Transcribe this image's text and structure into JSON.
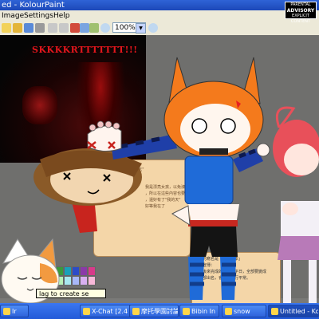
{
  "window": {
    "title": "ed - KolourPaint"
  },
  "menu": {
    "items": [
      "Image",
      "Settings",
      "Help"
    ]
  },
  "toolbar": {
    "zoom_value": "100%"
  },
  "canvas": {
    "photo_caption": "SKKKKRTTTTTTT!!!",
    "parental_label_top": "PARENTAL",
    "parental_label_main": "ADVISORY",
    "parental_label_bottom": "EXPLICIT CONTENT"
  },
  "speech_card": {
    "lines": [
      "將\"玉\"",
      "我是漂亮女孩，以免淑芸飛",
      "，所以在這些內容也要處理這",
      "，還好有了\"我的天\"",
      "好等我在了"
    ]
  },
  "note_card": {
    "lines": [
      "今天的寫名是「說說劇本」",
      "今天宣傳：",
      "大連後來完成的劇本對平日，全部要變成",
      "俱樂部出名，會為上例行平常。"
    ]
  },
  "tooltip": {
    "text": "lag to create se"
  },
  "taskbar": {
    "tasks": [
      {
        "label": "Ir",
        "active": false
      },
      {
        "label": "X-Chat [2.4",
        "active": false
      },
      {
        "label": "摩托學園討論",
        "active": false
      },
      {
        "label": "Bibin In",
        "active": false
      },
      {
        "label": "snow",
        "active": false
      },
      {
        "label": "Untitled - Ko",
        "active": true
      }
    ]
  },
  "colors": {
    "title_bar": "#1c48b8",
    "menu_bg": "#ece9d8",
    "hair_orange": "#f47a1c",
    "shirt_blue": "#1f6bd8",
    "taskbar": "#225ad8"
  },
  "icons": [
    "new-file-icon",
    "open-folder-icon",
    "save-icon",
    "print-icon",
    "undo-icon",
    "redo-icon",
    "cut-icon",
    "copy-icon",
    "paste-icon",
    "zoom-in-icon",
    "zoom-out-icon",
    "zoom-fit-icon"
  ]
}
